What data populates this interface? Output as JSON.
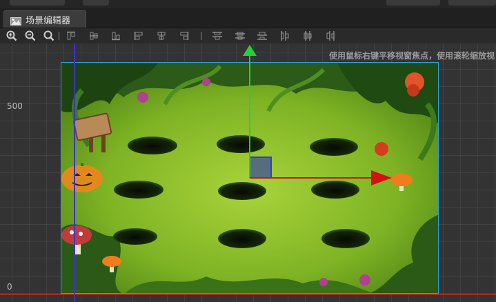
{
  "tab": {
    "label": "场景编辑器",
    "icon": "scene-editor-icon"
  },
  "toolbar": {
    "buttons": [
      {
        "name": "zoom-in-icon"
      },
      {
        "name": "zoom-out-icon"
      },
      {
        "name": "zoom-reset-icon"
      },
      {
        "name": "align-top-icon"
      },
      {
        "name": "align-vcenter-icon"
      },
      {
        "name": "align-bottom-icon"
      },
      {
        "name": "align-left-icon"
      },
      {
        "name": "align-hcenter-icon"
      },
      {
        "name": "align-right-icon"
      },
      {
        "name": "distribute-top-icon"
      },
      {
        "name": "distribute-vcenter-icon"
      },
      {
        "name": "distribute-bottom-icon"
      },
      {
        "name": "distribute-left-icon"
      },
      {
        "name": "distribute-hcenter-icon"
      },
      {
        "name": "distribute-right-icon"
      }
    ]
  },
  "viewport": {
    "hint": "使用鼠标右键平移视窗焦点，使用滚轮缩放视",
    "y_labels": [
      "500",
      "0"
    ]
  },
  "colors": {
    "axis_x": "#d41111",
    "axis_y": "#1fd43a",
    "selection": "#2aa3e6",
    "origin_y": "#3a36c0",
    "origin_x": "#b0261f"
  }
}
